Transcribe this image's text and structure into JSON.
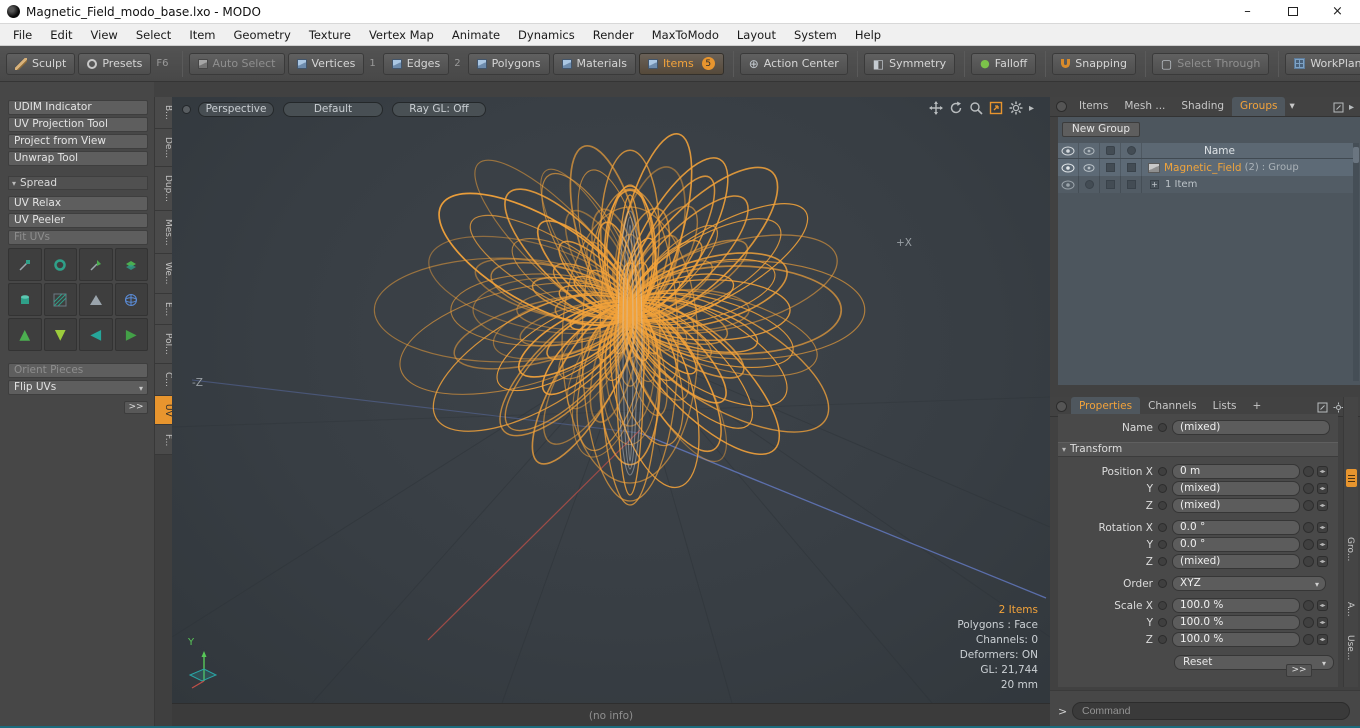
{
  "window": {
    "title": "Magnetic_Field_modo_base.lxo - MODO"
  },
  "menu": {
    "items": [
      "File",
      "Edit",
      "View",
      "Select",
      "Item",
      "Geometry",
      "Texture",
      "Vertex Map",
      "Animate",
      "Dynamics",
      "Render",
      "MaxToModo",
      "Layout",
      "System",
      "Help"
    ]
  },
  "toolbar": {
    "sculpt": "Sculpt",
    "presets": "Presets",
    "presets_key": "F6",
    "auto_select": "Auto Select",
    "vertices": "Vertices",
    "vertices_count": "1",
    "edges": "Edges",
    "edges_count": "2",
    "polygons": "Polygons",
    "materials": "Materials",
    "items": "Items",
    "items_count": "5",
    "action_center": "Action Center",
    "symmetry": "Symmetry",
    "falloff": "Falloff",
    "snapping": "Snapping",
    "select_through": "Select Through",
    "workplane": "WorkPlane"
  },
  "left_panel": {
    "tools1": [
      "UDIM Indicator",
      "UV Projection Tool",
      "Project from View",
      "Unwrap Tool"
    ],
    "section": "Spread",
    "tools2": [
      {
        "label": "UV Relax",
        "disabled": false
      },
      {
        "label": "UV Peeler",
        "disabled": false
      },
      {
        "label": "Fit UVs",
        "disabled": true
      }
    ],
    "orient": "Orient Pieces",
    "flip": "Flip UVs",
    "more": ">>"
  },
  "left_tabs": {
    "items": [
      "B...",
      "De...",
      "Dup...",
      "Mes...",
      "We...",
      "E...",
      "Pol...",
      "C...",
      "UV",
      "F..."
    ],
    "selected": "UV"
  },
  "viewport": {
    "controls": [
      "Perspective",
      "Default",
      "Ray GL: Off"
    ],
    "axis_labels": {
      "neg_z": "-Z",
      "pos_x": "+X",
      "gizmo_y": "Y"
    },
    "stats": [
      "2 Items",
      "Polygons : Face",
      "Channels: 0",
      "Deformers: ON",
      "GL: 21,744",
      "20 mm"
    ],
    "status": "(no info)"
  },
  "item_list": {
    "tabs": [
      "Items",
      "Mesh ...",
      "Shading",
      "Groups"
    ],
    "selected_tab": "Groups",
    "new_group_button": "New Group",
    "name_header": "Name",
    "rows": [
      {
        "name": "Magnetic_Field",
        "count": "(2)",
        "suffix": ": Group",
        "child": "1 Item"
      }
    ]
  },
  "properties": {
    "tabs": [
      "Properties",
      "Channels",
      "Lists",
      "+"
    ],
    "selected_tab": "Properties",
    "name_label": "Name",
    "name_value": "(mixed)",
    "section": "Transform",
    "rows": [
      {
        "label": "Position X",
        "value": "0 m",
        "type": "field",
        "group": true
      },
      {
        "label": "Y",
        "value": "(mixed)",
        "type": "field",
        "group": false
      },
      {
        "label": "Z",
        "value": "(mixed)",
        "type": "field",
        "group": false
      },
      {
        "label": "Rotation X",
        "value": "0.0 °",
        "type": "field",
        "group": true
      },
      {
        "label": "Y",
        "value": "0.0 °",
        "type": "field",
        "group": false
      },
      {
        "label": "Z",
        "value": "(mixed)",
        "type": "field",
        "group": false
      },
      {
        "label": "Order",
        "value": "XYZ",
        "type": "dropdown",
        "group": true
      },
      {
        "label": "Scale X",
        "value": "100.0 %",
        "type": "field",
        "group": true
      },
      {
        "label": "Y",
        "value": "100.0 %",
        "type": "field",
        "group": false
      },
      {
        "label": "Z",
        "value": "100.0 %",
        "type": "field",
        "group": false
      }
    ],
    "reset_button": "Reset",
    "more_button": ">>"
  },
  "right_tabs": {
    "items": [
      "Gro...",
      "A...",
      "Use..."
    ]
  },
  "command": {
    "prompt": ">",
    "value": "Command"
  },
  "colors": {
    "accent": "#e8952e",
    "field_line": "#f2a23a",
    "field_core": "#c9ced4",
    "axis_red": "#c05048",
    "axis_blue": "#6b84d8",
    "grid": "#2e3439"
  }
}
